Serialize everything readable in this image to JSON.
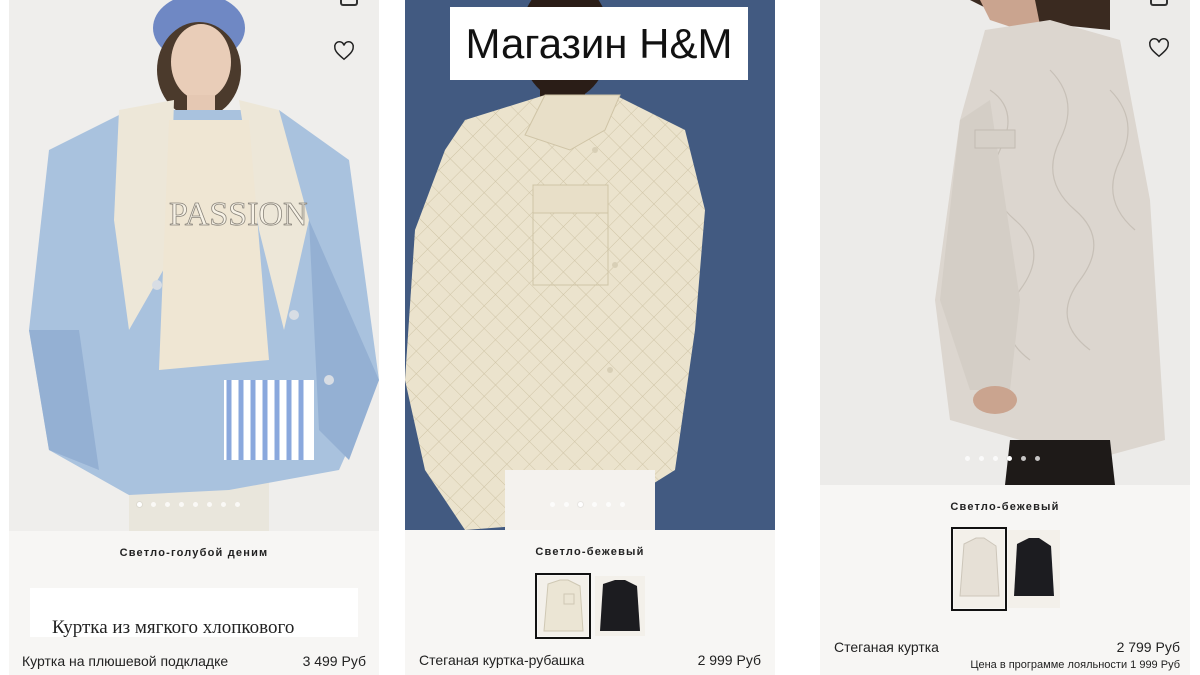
{
  "banner": {
    "title": "Магазин H&M"
  },
  "products": [
    {
      "color_name": "Светло-голубой деним",
      "name": "Куртка на плюшевой подкладке",
      "price": "3 499 Руб",
      "gallery_total": 8,
      "gallery_current": 1,
      "description_popup": "Куртка из мягкого хлопкового"
    },
    {
      "color_name": "Светло-бежевый",
      "name": "Стеганая куртка-рубашка",
      "price": "2 999 Руб",
      "gallery_total": 6,
      "gallery_current": 3,
      "swatches": [
        "light-beige",
        "black"
      ]
    },
    {
      "color_name": "Светло-бежевый",
      "name": "Стеганая куртка",
      "price": "2 799 Руб",
      "loyalty_price": "Цена в программе лояльности 1 999 Руб",
      "gallery_total": 6,
      "gallery_current": 4,
      "swatches": [
        "light-beige",
        "black"
      ]
    }
  ],
  "icons": {
    "favorite": "heart-outline-icon"
  },
  "colors": {
    "background": "#ffffff",
    "panel": "#f7f6f4",
    "text": "#222222",
    "selected_outline": "#111111"
  }
}
